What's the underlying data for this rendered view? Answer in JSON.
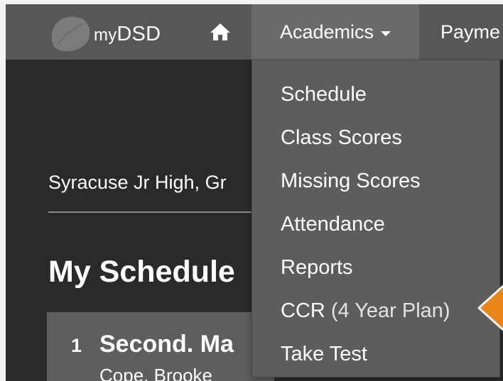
{
  "navbar": {
    "brand_prefix": "my",
    "brand_suffix": "DSD",
    "academics_label": "Academics",
    "payments_label": "Payme"
  },
  "dropdown": {
    "items": [
      {
        "label": "Schedule"
      },
      {
        "label": "Class Scores"
      },
      {
        "label": "Missing Scores"
      },
      {
        "label": "Attendance"
      },
      {
        "label": "Reports"
      },
      {
        "label": "CCR",
        "suffix": "(4 Year Plan)"
      },
      {
        "label": "Take Test"
      }
    ]
  },
  "page": {
    "school_line": "Syracuse Jr High, Gr",
    "title": "My Schedule",
    "classes": [
      {
        "period": "1",
        "name": "Second. Ma",
        "teacher": "Cope, Brooke"
      }
    ]
  },
  "colors": {
    "navbar": "#575757",
    "active_nav": "#6a6a6a",
    "dropdown": "#5d5d5d",
    "page_bg": "#2a2a2a",
    "pointer": "#e8841a"
  },
  "icons": {
    "logo": "leaf-logo-icon",
    "home": "home-icon",
    "caret": "chevron-down-icon",
    "pointer": "pointer-arrow-icon"
  }
}
